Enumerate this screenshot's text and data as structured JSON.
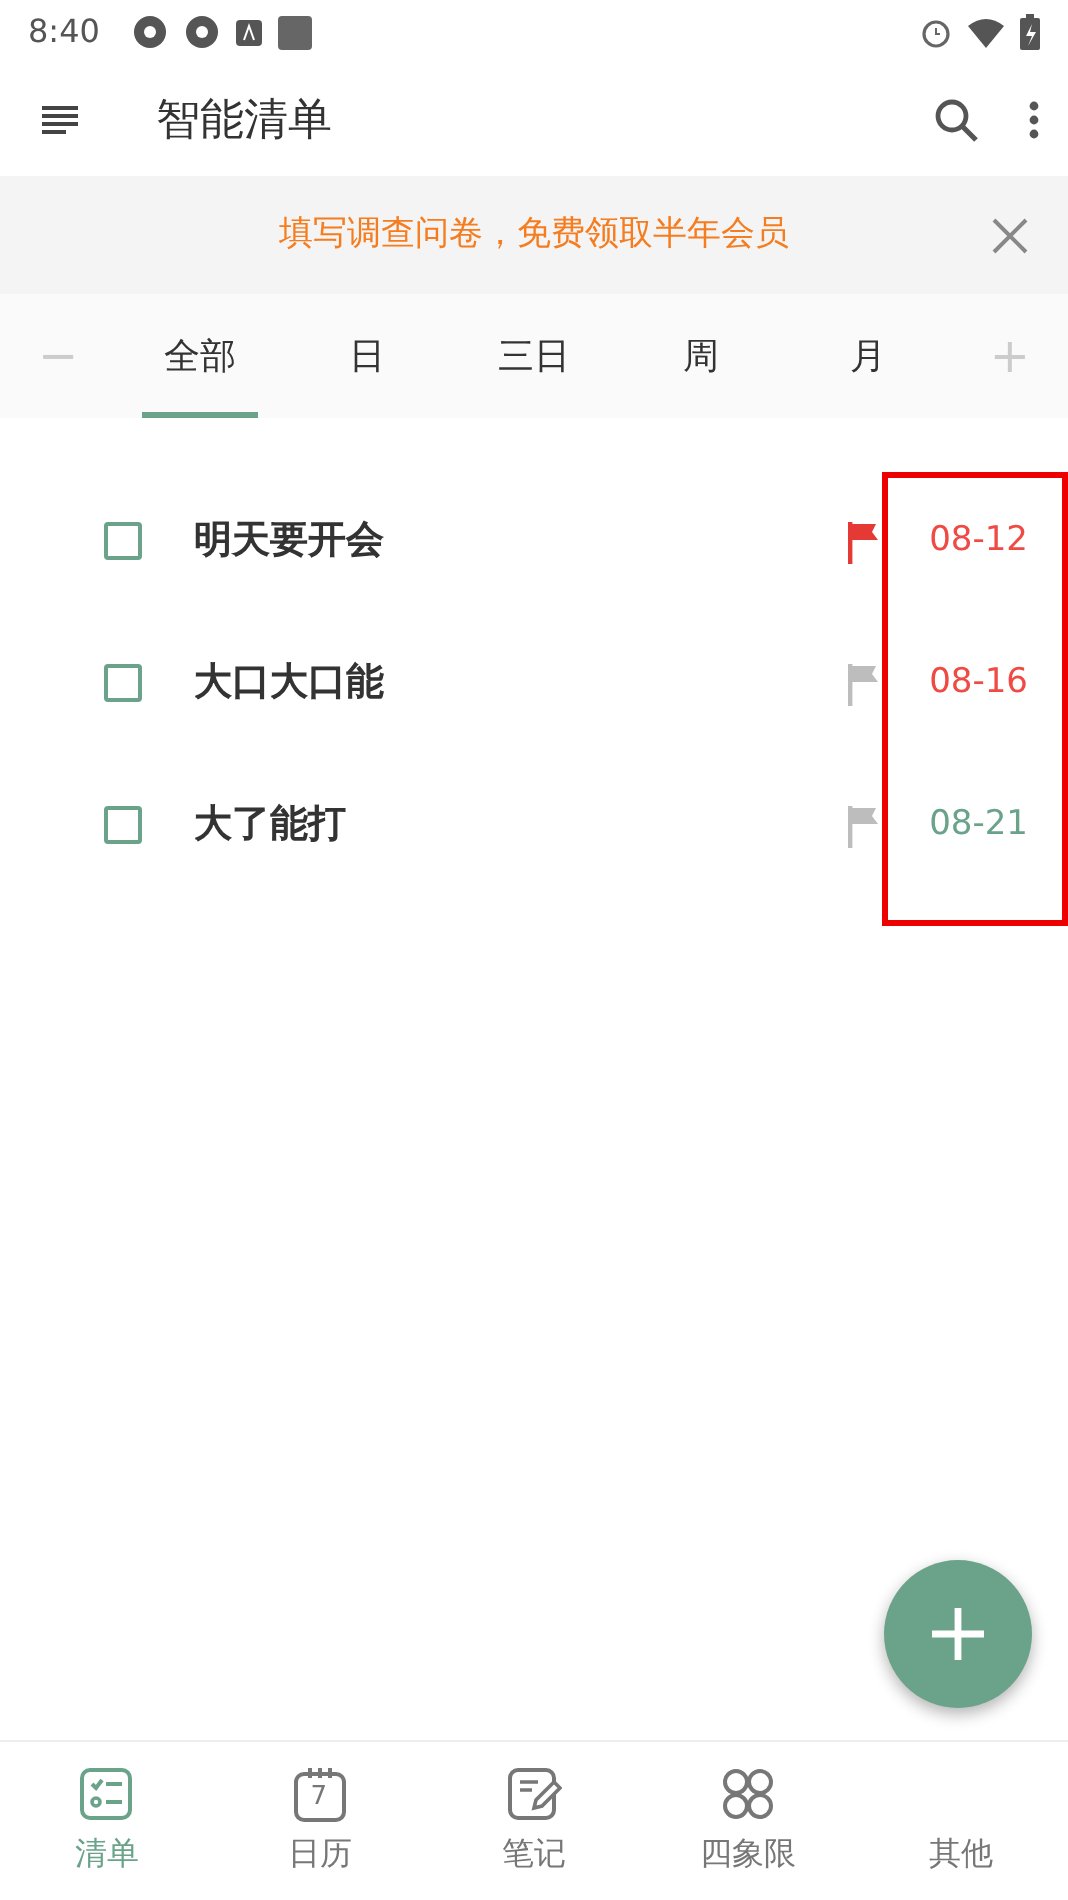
{
  "status_bar": {
    "time": "8:40"
  },
  "app_bar": {
    "title": "智能清单"
  },
  "banner": {
    "text": "填写调查问卷，免费领取半年会员"
  },
  "range_tabs": {
    "minus": "−",
    "plus": "+",
    "tabs": [
      {
        "label": "全部",
        "selected": true
      },
      {
        "label": "日",
        "selected": false
      },
      {
        "label": "三日",
        "selected": false
      },
      {
        "label": "周",
        "selected": false
      },
      {
        "label": "月",
        "selected": false
      }
    ]
  },
  "tasks": [
    {
      "title": "明天要开会",
      "checked": false,
      "flagged": true,
      "date": "08-12",
      "overdue": true
    },
    {
      "title": "大口大口能",
      "checked": false,
      "flagged": false,
      "date": "08-16",
      "overdue": true
    },
    {
      "title": "大了能打",
      "checked": false,
      "flagged": false,
      "date": "08-21",
      "overdue": false
    }
  ],
  "highlight_box": true,
  "bottom_nav": [
    {
      "label": "清单",
      "kind": "list",
      "selected": true
    },
    {
      "label": "日历",
      "kind": "calendar",
      "icon_text": "7",
      "selected": false
    },
    {
      "label": "笔记",
      "kind": "note",
      "selected": false
    },
    {
      "label": "四象限",
      "kind": "quadrant",
      "selected": false
    },
    {
      "label": "其他",
      "kind": "other",
      "selected": false
    }
  ]
}
